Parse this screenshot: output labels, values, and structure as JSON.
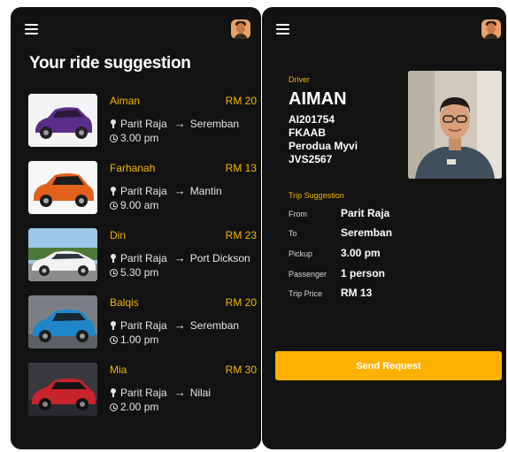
{
  "left": {
    "title": "Your ride suggestion",
    "rides": [
      {
        "name": "Aiman",
        "price": "RM 20",
        "from": "Parit Raja",
        "to": "Seremban",
        "time": "3.00 pm",
        "car_color": "#5a2d86"
      },
      {
        "name": "Farhanah",
        "price": "RM 13",
        "from": "Parit Raja",
        "to": "Mantin",
        "time": "9.00 am",
        "car_color": "#e2611c"
      },
      {
        "name": "Din",
        "price": "RM 23",
        "from": "Parit Raja",
        "to": "Port Dickson",
        "time": "5.30 pm",
        "car_color": "#f2f2f2"
      },
      {
        "name": "Balqis",
        "price": "RM 20",
        "from": "Parit Raja",
        "to": "Seremban",
        "time": "1.00 pm",
        "car_color": "#1f86c9"
      },
      {
        "name": "Mia",
        "price": "RM 30",
        "from": "Parit Raja",
        "to": "Nilai",
        "time": "2.00 pm",
        "car_color": "#c8242b"
      }
    ]
  },
  "right": {
    "driver_label": "Driver",
    "driver_name": "AIMAN",
    "driver_lines": [
      "AI201754",
      "FKAAB",
      "Perodua Myvi",
      "JVS2567"
    ],
    "trip_label": "Trip Suggestion",
    "trip": [
      {
        "key": "From",
        "value": "Parit Raja"
      },
      {
        "key": "To",
        "value": "Seremban"
      },
      {
        "key": "Pickup",
        "value": "3.00 pm"
      },
      {
        "key": "Passenger",
        "value": "1 person"
      },
      {
        "key": "Trip Price",
        "value": "RM 13"
      }
    ],
    "send_label": "Send Request"
  },
  "icons": {
    "menu": "menu-icon",
    "avatar": "avatar",
    "pin": "pin-icon",
    "clock": "clock-icon",
    "arrow": "arrow-right-icon"
  },
  "colors": {
    "accent": "#f7b500",
    "button": "#ffb100",
    "background": "#121212"
  }
}
